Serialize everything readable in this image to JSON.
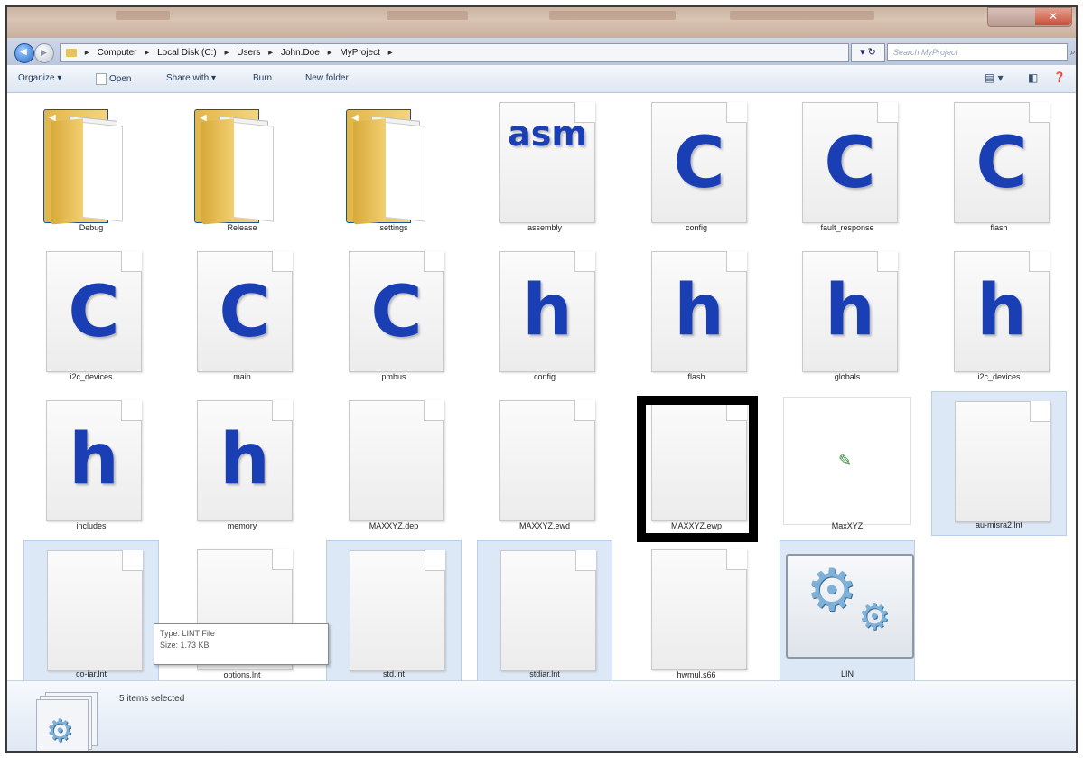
{
  "window": {
    "close_label": "✕"
  },
  "address_bar": {
    "crumbs": [
      "Computer",
      "Local Disk (C:)",
      "Users",
      "John.Doe",
      "MyProject"
    ],
    "separator": "▸",
    "refresh_label": "▾ ↻",
    "search_placeholder": "Search MyProject",
    "search_icon": "search-icon"
  },
  "toolbar": {
    "organize": "Organize ▾",
    "open": "Open",
    "share_with": "Share with ▾",
    "burn": "Burn",
    "new_folder": "New folder",
    "view_icon": "▤ ▾",
    "pane_icon": "◧",
    "help_icon": "❓"
  },
  "items": [
    {
      "name": "Debug",
      "type": "folder"
    },
    {
      "name": "Release",
      "type": "folder"
    },
    {
      "name": "settings",
      "type": "folder"
    },
    {
      "name": "assembly",
      "type": "asm",
      "glyph": "asm"
    },
    {
      "name": "config",
      "type": "c",
      "glyph": "C"
    },
    {
      "name": "fault_response",
      "type": "c",
      "glyph": "C"
    },
    {
      "name": "flash",
      "type": "c",
      "glyph": "C"
    },
    {
      "name": "i2c_devices",
      "type": "c",
      "glyph": "C"
    },
    {
      "name": "main",
      "type": "c",
      "glyph": "C"
    },
    {
      "name": "pmbus",
      "type": "c",
      "glyph": "C"
    },
    {
      "name": "config",
      "type": "h",
      "glyph": "h"
    },
    {
      "name": "flash",
      "type": "h",
      "glyph": "h"
    },
    {
      "name": "globals",
      "type": "h",
      "glyph": "h"
    },
    {
      "name": "i2c_devices",
      "type": "h",
      "glyph": "h"
    },
    {
      "name": "includes",
      "type": "h",
      "glyph": "h"
    },
    {
      "name": "memory",
      "type": "h",
      "glyph": "h"
    },
    {
      "name": "MAXXYZ.dep",
      "type": "blank"
    },
    {
      "name": "MAXXYZ.ewd",
      "type": "blank"
    },
    {
      "name": "MAXXYZ.ewp",
      "type": "blank",
      "highlighted": true
    },
    {
      "name": "MaxXYZ",
      "type": "workspace"
    },
    {
      "name": "au-misra2.lnt",
      "type": "blank",
      "selected": true
    },
    {
      "name": "co-iar.lnt",
      "type": "blank",
      "selected": true
    },
    {
      "name": "options.lnt",
      "type": "blank"
    },
    {
      "name": "std.lnt",
      "type": "blank",
      "selected": true
    },
    {
      "name": "stdiar.lnt",
      "type": "blank",
      "selected": true
    },
    {
      "name": "hwmul.s66",
      "type": "blank"
    },
    {
      "name": "LIN",
      "type": "shortcut",
      "selected": true
    }
  ],
  "tooltip": {
    "type_line": "Type: LINT File",
    "size_line": "Size: 1.73 KB"
  },
  "status": {
    "message": "5 items selected"
  },
  "colors": {
    "selection_bg": "#dde8f7",
    "glyph_blue": "#1a3fb5",
    "folder_yellow": "#f2cf70"
  }
}
